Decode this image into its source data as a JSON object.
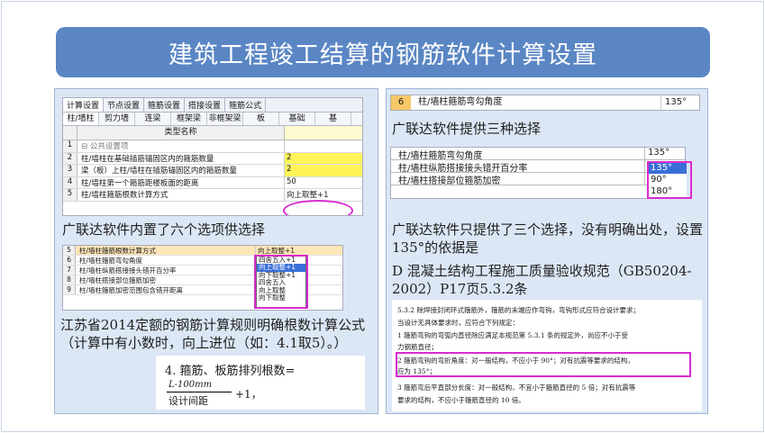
{
  "title": "建筑工程竣工结算的钢筋软件计算设置",
  "left": {
    "tabs_top": [
      "计算设置",
      "节点设置",
      "箍筋设置",
      "搭接设置",
      "箍筋公式"
    ],
    "tabs_sub": [
      "柱/墙柱",
      "剪力墙",
      "连梁",
      "框架梁",
      "非框架梁",
      "板",
      "基础",
      "基"
    ],
    "grid_header": "类型名称",
    "grid_rows": [
      {
        "num": "1",
        "name": "⊟ 公共设置项",
        "value": ""
      },
      {
        "num": "2",
        "name": "柱/墙柱在基础插筋锚固区内的箍筋数量",
        "value": "2"
      },
      {
        "num": "3",
        "name": "梁（板）上柱/墙柱在插筋锚固区内的箍筋数量",
        "value": "2"
      },
      {
        "num": "4",
        "name": "柱/墙柱第一个箍筋距楼板面的距离",
        "value": "50"
      },
      {
        "num": "5",
        "name": "柱/墙柱箍筋根数计算方式",
        "value": "向上取整+1"
      }
    ],
    "caption1": "广联达软件内置了六个选项供选择",
    "shot2_rows": [
      {
        "num": "5",
        "name": "柱/墙柱箍筋根数计算方式",
        "value": "向上取整+1"
      },
      {
        "num": "6",
        "name": "柱/墙柱箍筋弯勾角度",
        "value": ""
      },
      {
        "num": "7",
        "name": "柱/墙柱纵筋搭接接头错开百分率",
        "value": ""
      },
      {
        "num": "8",
        "name": "柱/墙柱搭接部位箍筋加密",
        "value": ""
      },
      {
        "num": "9",
        "name": "柱/墙柱箍筋加密范围包含错开距离",
        "value": ""
      }
    ],
    "dropdown_options": [
      "四舍五入+1",
      "向上取整+1",
      "向下取整+1",
      "四舍五入",
      "向上取整",
      "向下取整"
    ],
    "dropdown_selected": "向上取整+1",
    "caption2": "江苏省2014定额的钢筋计算规则明确根数计算公式（计算中有小数时，向上进位（如：4.1取5）。）",
    "formula": {
      "title": "4. 箍筋、板筋排列根数=",
      "numerator": "L-100mm",
      "denominator": "设计间距",
      "suffix": "+1，"
    }
  },
  "right": {
    "shot3": {
      "num": "6",
      "name": "柱/墙柱箍筋弯勾角度",
      "value": "135°"
    },
    "caption1": "广联达软件提供三种选择",
    "shot4_rows": [
      {
        "name": "柱/墙柱箍筋弯勾角度",
        "value": "135°"
      },
      {
        "name": "柱/墙柱纵筋搭接接头错开百分率",
        "value": ""
      },
      {
        "name": "柱/墙柱搭接部位箍筋加密",
        "value": ""
      }
    ],
    "angle_options": [
      "135°",
      "90°",
      "180°"
    ],
    "angle_selected": "135°",
    "caption2": "广联达软件只提供了三个选择，没有明确出处，设置135°的依据是",
    "caption3": "D 混凝土结构工程施工质量验收规范（GB50204-2002）P17页5.3.2条",
    "spec_lines": [
      "5.3.2  除焊接封闭环式箍筋外，箍筋的末端应作弯钩，弯钩形式应符合设计要求；",
      "当设计无具体要求时，应符合下列规定：",
      "1  箍筋弯钩的弯弧内直径除应满足本规范第 5.3.1 条的规定外，尚应不小于受",
      "力钢筋直径；",
      "2  箍筋弯钩的弯折角度：对一般结构，不应小于 90°；对有抗震等要求的结构，",
      "应为 135°；",
      "3  箍筋弯后平直部分长度：对一般结构，不宜小于箍筋直径的 5 倍；对有抗震等",
      "要求的结构，不应小于箍筋直径的 10 倍。"
    ]
  }
}
